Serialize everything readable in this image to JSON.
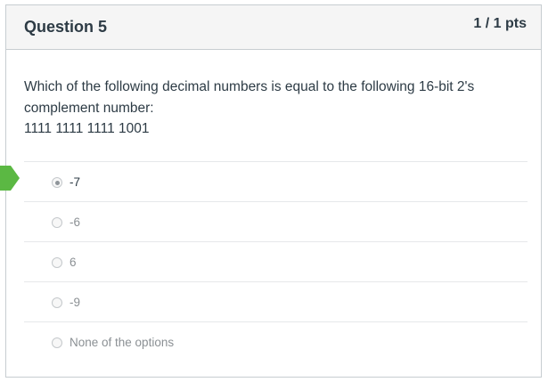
{
  "question": {
    "title": "Question 5",
    "points": "1 / 1 pts",
    "text_line1": "Which of the following decimal numbers is equal to  the following 16-bit 2's complement number:",
    "text_line2": "1111 1111 1111 1001"
  },
  "answers": [
    {
      "label": "-7",
      "selected": true
    },
    {
      "label": "-6",
      "selected": false
    },
    {
      "label": "6",
      "selected": false
    },
    {
      "label": "-9",
      "selected": false
    },
    {
      "label": "None of the options",
      "selected": false
    }
  ],
  "colors": {
    "correct_marker": "#5bb843",
    "text": "#2d3b45",
    "muted_text": "#8b9094",
    "header_bg": "#f5f5f5",
    "border": "#c7cdd1"
  },
  "icons": {
    "correct_marker": "correct-answer-arrow-icon"
  }
}
